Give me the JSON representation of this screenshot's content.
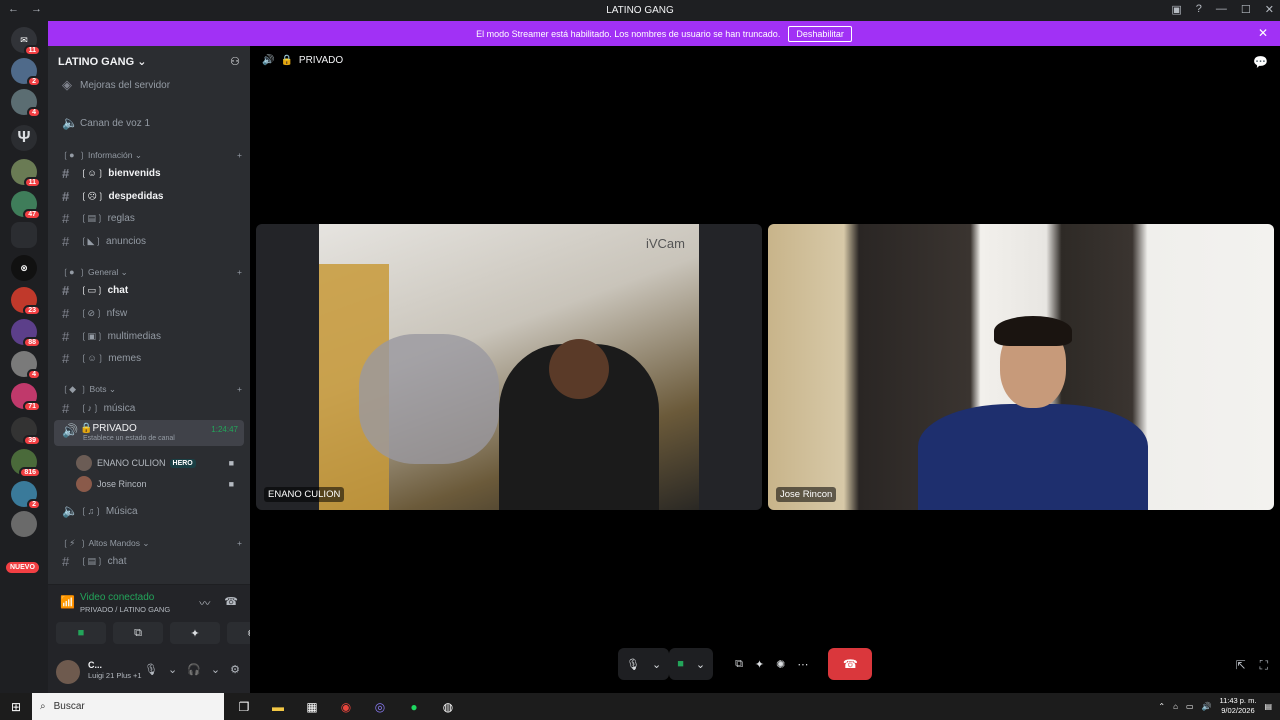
{
  "window": {
    "title": "LATINO GANG"
  },
  "banner": {
    "text": "El modo Streamer está habilitado. Los nombres de usuario se han truncado.",
    "button": "Deshabilitar"
  },
  "guilds": {
    "badges": [
      "11",
      "2",
      "4",
      "",
      "11",
      "47",
      "",
      "",
      "23",
      "88",
      "4",
      "71",
      "39",
      "816",
      "2",
      ""
    ],
    "new_label": "NUEVO"
  },
  "server": {
    "name": "LATINO GANG"
  },
  "channels": {
    "boost": "Mejoras del servidor",
    "voice1": "Canan de voz 1",
    "cat_info": "Información",
    "bienvenids": "bienvenids",
    "despedidas": "despedidas",
    "reglas": "reglas",
    "anuncios": "anuncios",
    "cat_general": "General",
    "chat": "chat",
    "nfsw": "nfsw",
    "multimedias": "multimedias",
    "memes": "memes",
    "cat_bots": "Bots",
    "musica": "música",
    "privado": "PRIVADO",
    "privado_status": "Establece un estado de canal",
    "privado_timer": "1:24:47",
    "user1": "ENANO CULION",
    "user1_tag": "HERO",
    "user2": "Jose Rincon",
    "musica2": "Música",
    "cat_altos": "Altos Mandos",
    "chat2": "chat"
  },
  "voice_panel": {
    "status": "Video conectado",
    "location": "PRIVADO / LATINO GANG"
  },
  "user_panel": {
    "name": "C...",
    "activity": "Luigi 21 Plus +1"
  },
  "stage": {
    "channel": "PRIVADO",
    "tile1_label": "ENANO CULION",
    "tile1_watermark": "iVCam",
    "tile2_label": "Jose Rincon"
  },
  "taskbar": {
    "search": "Buscar",
    "time": "11:43 p. m.",
    "date": "9/02/2026"
  },
  "colors": {
    "accent": "#a131f5",
    "connected": "#23a55a",
    "hangup": "#da373c"
  }
}
